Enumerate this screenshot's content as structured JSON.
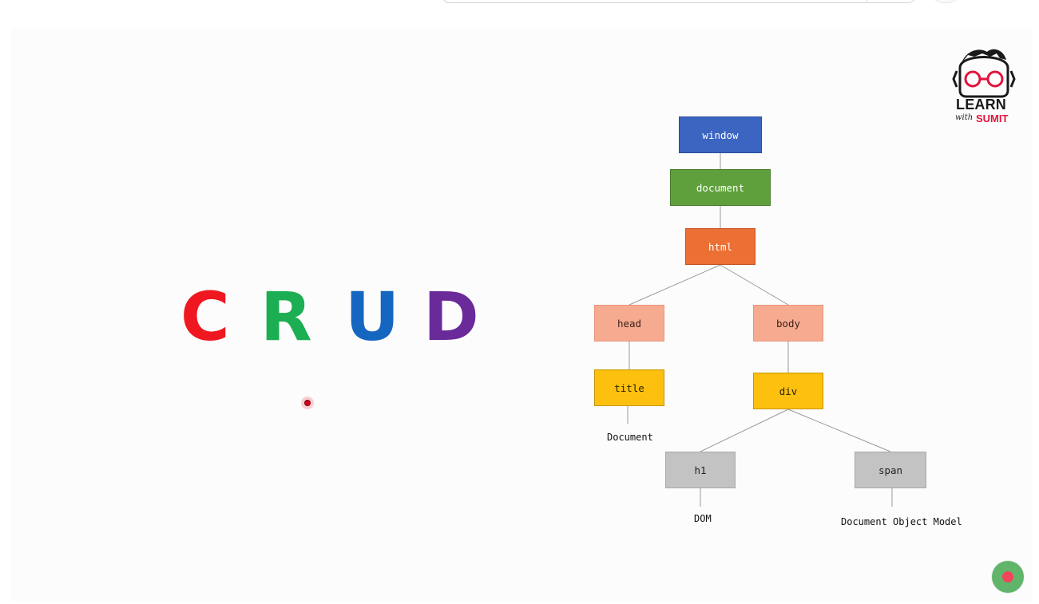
{
  "crud": {
    "letters": [
      "C",
      "R",
      "U",
      "D"
    ]
  },
  "tree": {
    "nodes": {
      "window": "window",
      "document": "document",
      "html": "html",
      "head": "head",
      "body": "body",
      "title": "title",
      "div": "div",
      "h1": "h1",
      "span": "span"
    },
    "leaves": {
      "title_text": "Document",
      "h1_text": "DOM",
      "span_text": "Document Object Model"
    }
  },
  "logo": {
    "learn": "LEARN",
    "with": "with",
    "sumit": "SUMIT"
  },
  "colors": {
    "crud_c": "#f01820",
    "crud_r": "#1cae52",
    "crud_u": "#1566c0",
    "crud_d": "#6a2a9a",
    "node_window": "#3b65c1",
    "node_document": "#5fa03c",
    "node_html": "#ec6f34",
    "node_head_body": "#f6ab90",
    "node_title_div": "#fdc00f",
    "node_h1_span": "#c3c3c3",
    "logo_accent": "#e2143c",
    "record_button": "#60b56a"
  }
}
